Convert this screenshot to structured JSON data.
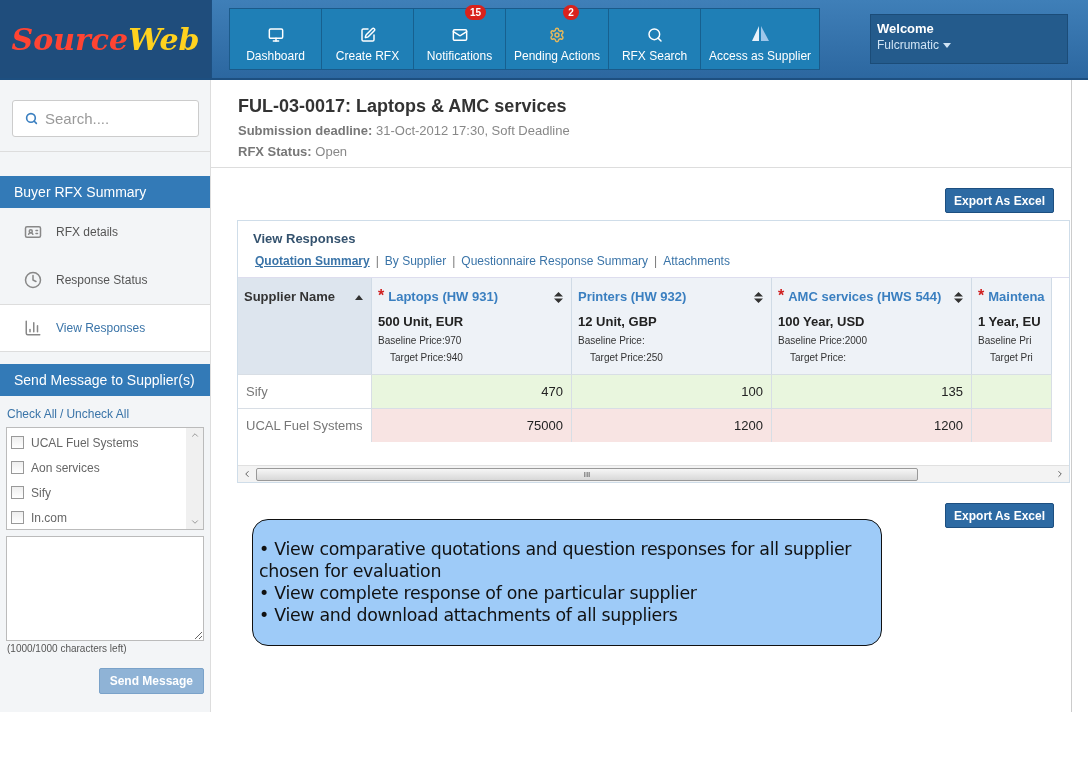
{
  "logo": [
    {
      "text": "Source",
      "color": "#ff4433"
    },
    {
      "text": "Web",
      "color": "#ffd21f"
    }
  ],
  "nav": [
    {
      "label": "Dashboard",
      "kind": "monitor"
    },
    {
      "label": "Create RFX",
      "kind": "edit"
    },
    {
      "label": "Notifications",
      "kind": "mail",
      "badge": "15"
    },
    {
      "label": "Pending Actions",
      "kind": "gear",
      "badge": "2"
    },
    {
      "label": "RFX Search",
      "kind": "search"
    },
    {
      "label": "Access as Supplier",
      "kind": "sail"
    }
  ],
  "user": {
    "greeting": "Welcome",
    "name": "Fulcrumatic"
  },
  "sidebar": {
    "search": {
      "placeholder": "Search...."
    },
    "summary": {
      "title": "Buyer RFX Summary",
      "items": [
        {
          "label": "RFX details",
          "kind": "card",
          "selected": false
        },
        {
          "label": "Response Status",
          "kind": "clock",
          "selected": false
        },
        {
          "label": "View Responses",
          "kind": "chart",
          "selected": true
        }
      ]
    },
    "message": {
      "title": "Send Message to Supplier(s)",
      "check_all": "Check All",
      "separator": "/",
      "uncheck_all": "Uncheck All",
      "suppliers": [
        {
          "label": "UCAL Fuel Systems",
          "checked": false
        },
        {
          "label": "Aon services",
          "checked": false
        },
        {
          "label": "Sify",
          "checked": false
        },
        {
          "label": "In.com",
          "checked": false
        }
      ],
      "counter": "(1000/1000 characters left)",
      "send": {
        "label": "Send Message",
        "disabled": true
      }
    }
  },
  "rfx": {
    "title": "FUL-03-0017: Laptops & AMC services",
    "deadline_label": "Submission deadline:",
    "deadline": "31-Oct-2012 17:30, Soft Deadline",
    "status_label": "RFX Status:",
    "status": "Open"
  },
  "export_buttons": [
    "Export As Excel",
    "Export As Excel"
  ],
  "responses": {
    "title": "View Responses",
    "tabs": [
      {
        "label": "Quotation Summary",
        "selected": true,
        "separator": "|"
      },
      {
        "label": "By Supplier",
        "selected": false,
        "separator": "|"
      },
      {
        "label": "Questionnaire Response Summary",
        "selected": false,
        "separator": "|"
      },
      {
        "label": "Attachments",
        "selected": false
      }
    ],
    "table": {
      "first_column": "Supplier Name",
      "columns": [
        {
          "name": "Laptops (HW 931)",
          "required_mark": "*",
          "qty": "500 Unit, EUR",
          "baseline": "Baseline Price:970",
          "target": "Target Price:940"
        },
        {
          "name": "Printers (HW 932)",
          "qty": "12 Unit, GBP",
          "baseline": "Baseline Price:",
          "target": "Target Price:250"
        },
        {
          "name": "AMC services (HWS 544)",
          "required_mark": "*",
          "qty": "100 Year, USD",
          "baseline": "Baseline Price:2000",
          "target": "Target Price:"
        },
        {
          "name": "Maintena",
          "required_mark": "*",
          "qty": "1 Year, EU",
          "baseline": "Baseline Pri",
          "target": "Target Pri"
        }
      ],
      "rows": [
        {
          "supplier": "Sify",
          "color": "#e9f6de",
          "values": [
            "470",
            "100",
            "135"
          ]
        },
        {
          "supplier": "UCAL Fuel Systems",
          "color": "#f8e4e3",
          "values": [
            "75000",
            "1200",
            "1200"
          ]
        }
      ]
    },
    "scrollbar_grip": "III"
  },
  "callout": [
    "• View comparative quotations and question responses for all supplier chosen for evaluation",
    "• View complete response of one particular supplier",
    "• View and download attachments of all suppliers"
  ]
}
